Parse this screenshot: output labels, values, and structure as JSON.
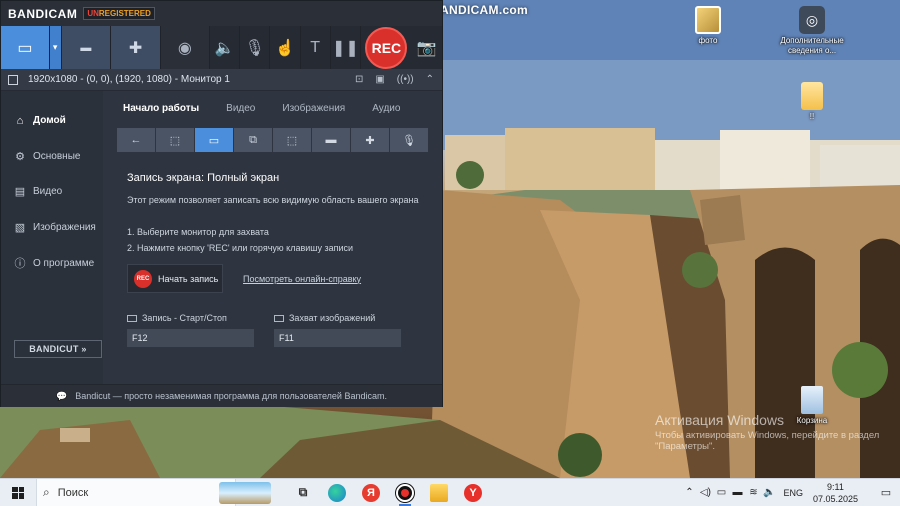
{
  "watermark": "www.BANDICAM.com",
  "desktop_icons": [
    {
      "label": "фото",
      "icon": "photo-folder-icon"
    },
    {
      "label": "Дополнительные сведения о...",
      "icon": "info-shortcut-icon"
    },
    {
      "label": "!!",
      "icon": "folder-icon"
    },
    {
      "label": "Корзина",
      "icon": "recycle-bin-icon"
    }
  ],
  "activate": {
    "line1": "Активация Windows",
    "line2": "Чтобы активировать Windows, перейдите в раздел \"Параметры\"."
  },
  "bandicam": {
    "logo": "BANDICAM",
    "unreg_a": "UN",
    "unreg_b": "REGISTERED",
    "rec_label": "REC",
    "status": "1920x1080 - (0, 0), (1920, 1080) - Монитор 1",
    "sidebar": [
      {
        "label": "Домой",
        "icon": "home-icon"
      },
      {
        "label": "Основные",
        "icon": "gear-icon"
      },
      {
        "label": "Видео",
        "icon": "video-icon"
      },
      {
        "label": "Изображения",
        "icon": "image-icon"
      },
      {
        "label": "О программе",
        "icon": "info-icon"
      }
    ],
    "bandicut": "BANDICUT »",
    "tabs": [
      "Начало работы",
      "Видео",
      "Изображения",
      "Аудио"
    ],
    "content": {
      "title": "Запись экрана: Полный экран",
      "desc": "Этот режим позволяет записать всю видимую область вашего экрана",
      "step1": "1. Выберите монитор для захвата",
      "step2": "2. Нажмите кнопку 'REC' или горячую клавишу записи",
      "start_rec_mini": "REC",
      "start": "Начать запись",
      "help": "Посмотреть онлайн-справку",
      "hk1_label": "Запись - Старт/Стоп",
      "hk1_value": "F12",
      "hk2_label": "Захват изображений",
      "hk2_value": "F11"
    },
    "footer": "Bandicut — просто незаменимая программа для пользователей Bandicam."
  },
  "taskbar": {
    "search": "Поиск",
    "lang": "ENG",
    "time": "9:11",
    "date": "07.05.2025"
  }
}
